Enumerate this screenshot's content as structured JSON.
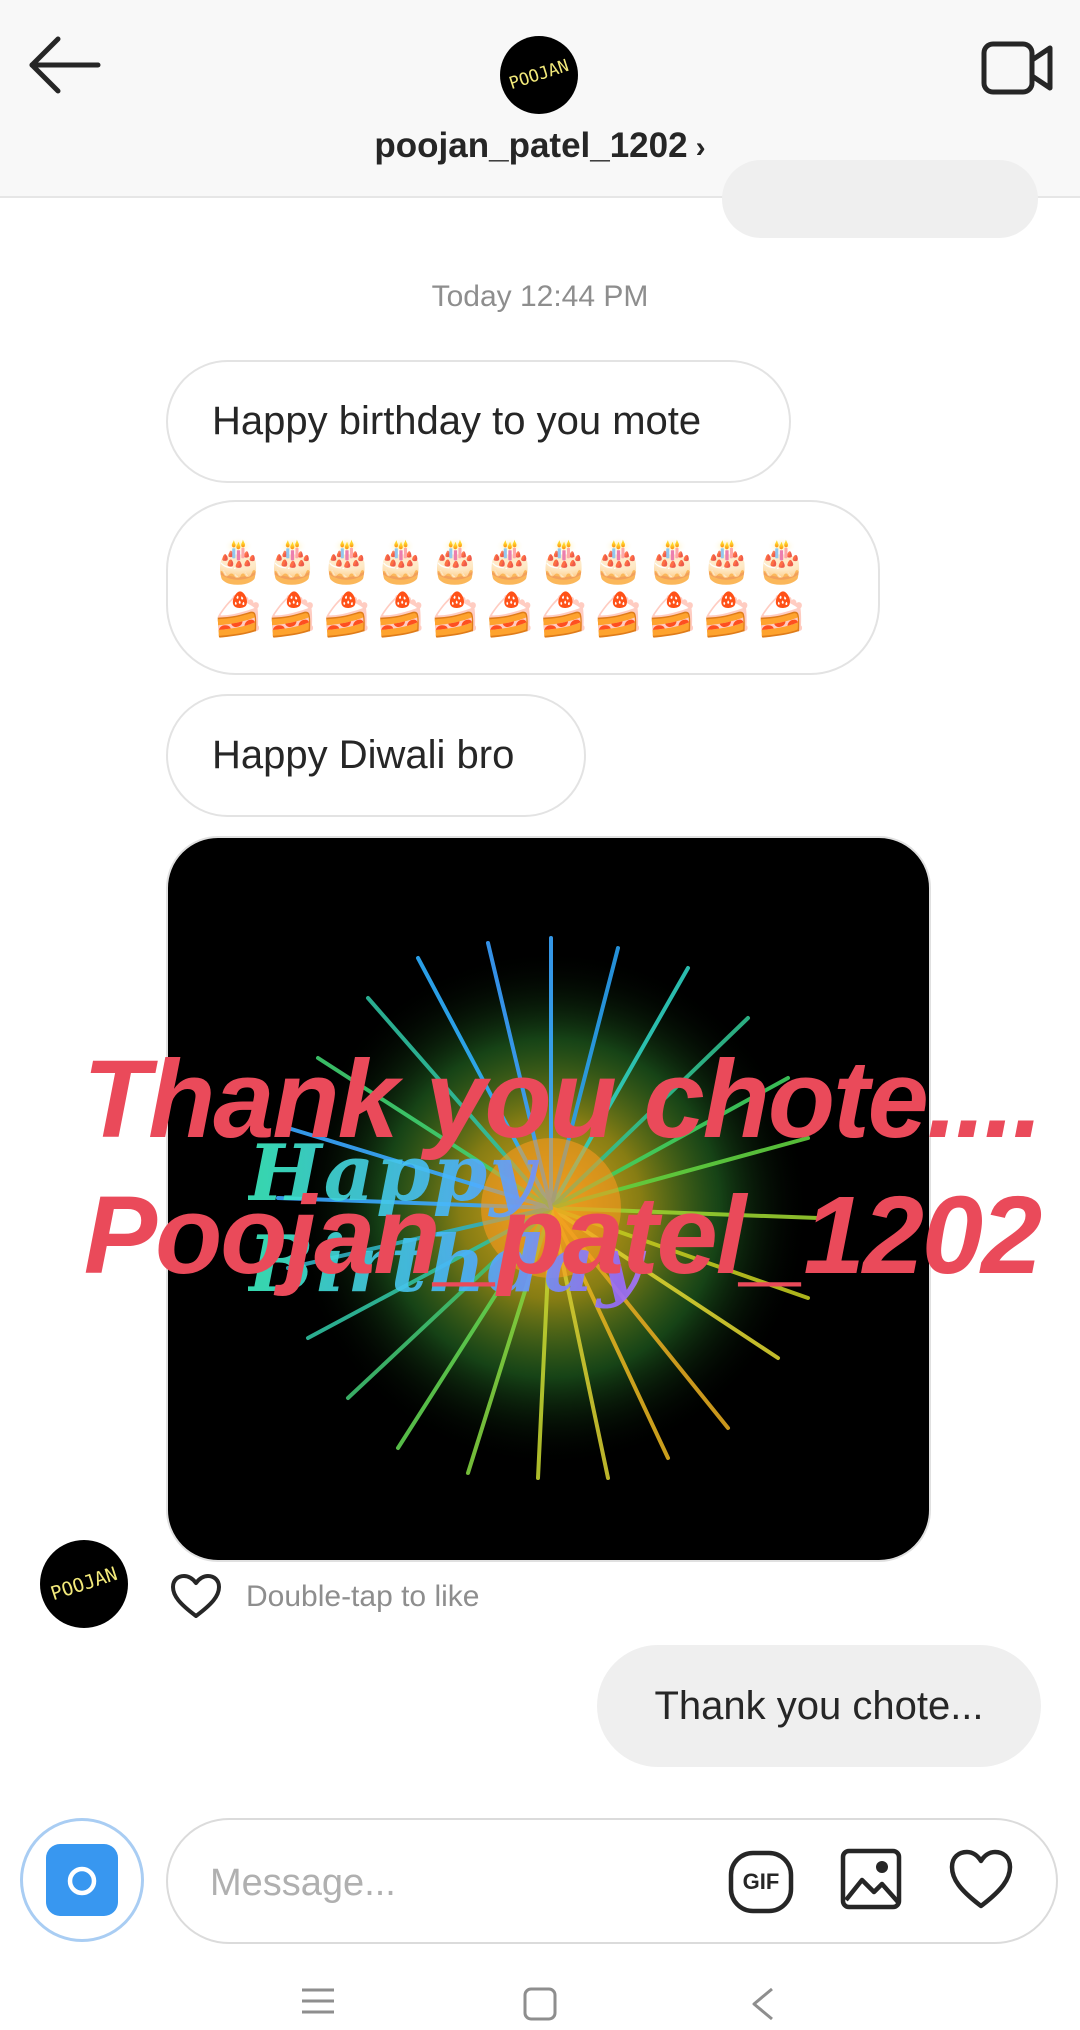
{
  "header": {
    "username": "poojan_patel_1202",
    "chevron": "›",
    "avatar_text": "POOJAN"
  },
  "chat": {
    "timestamp": "Today 12:44 PM",
    "incoming": [
      "Happy birthday to you mote",
      "🎂🎂🎂🎂🎂🎂🎂🎂🎂🎂🎂🍰🍰🍰🍰🍰🍰🍰🍰🍰🍰🍰",
      "Happy Diwali bro"
    ],
    "image": {
      "caption_art": "Happy Birthday"
    },
    "overlay": {
      "line1": "Thank you chote....",
      "line2": "Poojan_patel_1202"
    },
    "avatar_text": "POOJAN",
    "like_hint": "Double-tap to like",
    "outgoing": "Thank you chote..."
  },
  "composer": {
    "placeholder": "Message...",
    "gif_label": "GIF"
  },
  "colors": {
    "accent": "#3897f0",
    "overlay_text": "#ea4a5a",
    "bubble_out": "#efefef",
    "muted": "#8e8e8e"
  },
  "icons": [
    "back-arrow-icon",
    "video-call-icon",
    "heart-icon",
    "camera-icon",
    "gif-icon",
    "gallery-icon",
    "menu-icon",
    "home-icon",
    "back-icon"
  ]
}
